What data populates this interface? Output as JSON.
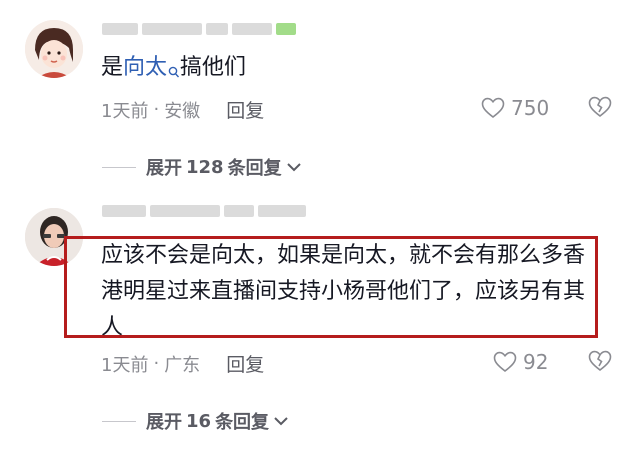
{
  "comments": [
    {
      "text_before": "是",
      "mention": "向太",
      "text_after": "搞他们",
      "time": "1天前",
      "separator": "·",
      "location": "安徽",
      "reply_label": "回复",
      "likes": "750",
      "expand": {
        "prefix": "展开",
        "count": "128",
        "suffix": "条回复"
      }
    },
    {
      "text": "应该不会是向太，如果是向太，就不会有那么多香港明星过来直播间支持小杨哥他们了，应该另有其人",
      "time": "1天前",
      "separator": "·",
      "location": "广东",
      "reply_label": "回复",
      "likes": "92",
      "expand": {
        "prefix": "展开",
        "count": "16",
        "suffix": "条回复"
      }
    }
  ],
  "colors": {
    "mention": "#2f5fb3",
    "highlight_border": "#b51c1c",
    "meta_text": "#8a8b91"
  },
  "icons": [
    "search-mini-icon",
    "heart-outline-icon",
    "broken-heart-icon",
    "chevron-down-icon"
  ]
}
